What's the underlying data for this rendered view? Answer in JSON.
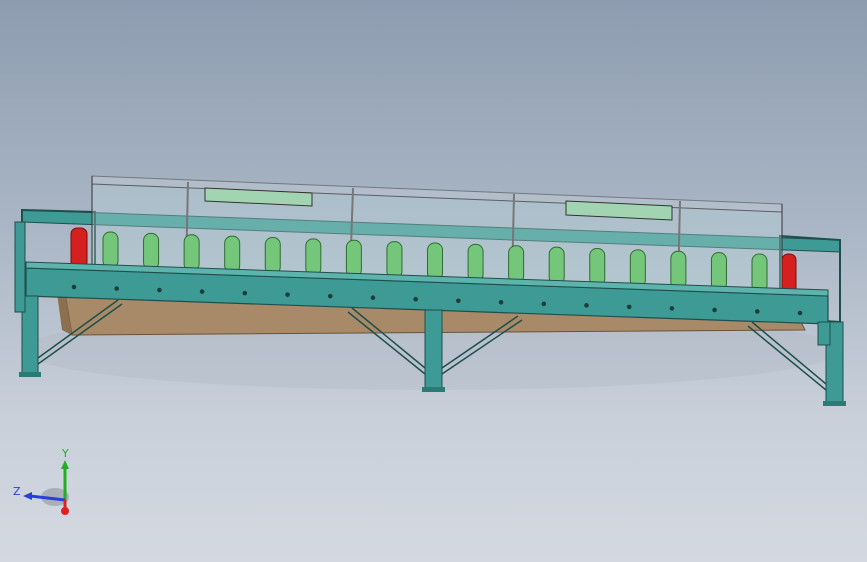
{
  "viewport": {
    "background_top": "#8d9cb0",
    "background_bottom": "#d4d9e1"
  },
  "model": {
    "frame_color": "#3d9a94",
    "frame_edge_color": "#1f4f4c",
    "roller_color": "#74c77a",
    "roller_count": 17,
    "tray_color": "#a98a68",
    "end_cap_color": "#d61f1f",
    "panel_color": "#a3d4b2",
    "bolt_hole_count": 18
  },
  "triad": {
    "x_label": "",
    "y_label": "Y",
    "z_label": "Z",
    "x_color": "#e02020",
    "y_color": "#22b022",
    "z_color": "#2a3ed8"
  }
}
